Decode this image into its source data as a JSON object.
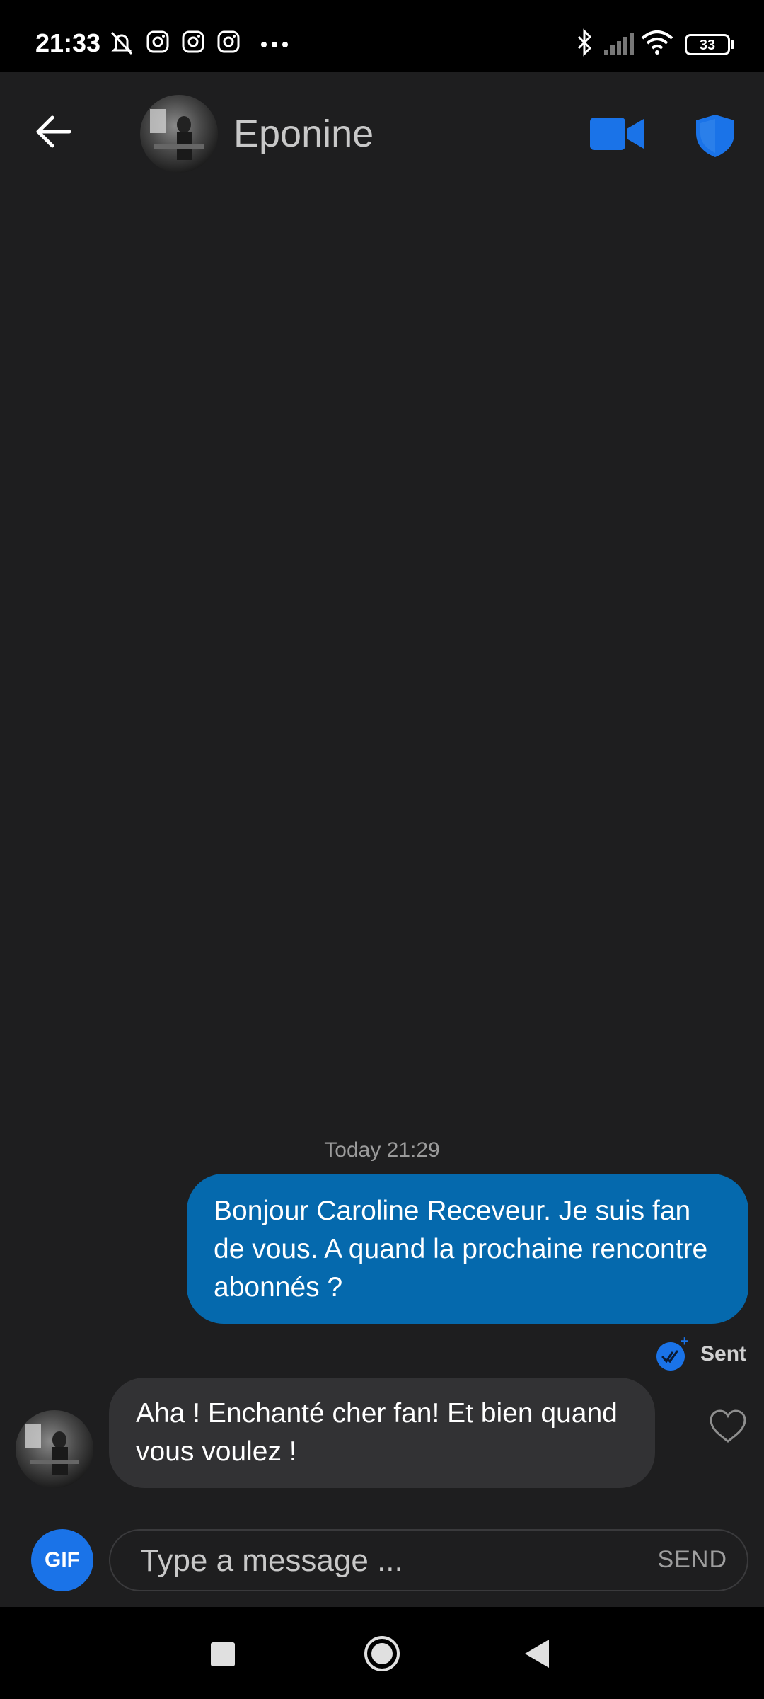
{
  "status_bar": {
    "time": "21:33",
    "battery": "33",
    "icons": [
      "muted-bell-icon",
      "instagram-icon",
      "instagram-icon",
      "instagram-icon",
      "more-dots-icon",
      "bluetooth-icon",
      "signal-icon",
      "wifi-icon",
      "battery-icon"
    ]
  },
  "header": {
    "contact_name": "Eponine",
    "icons": {
      "back": "arrow-left-icon",
      "video": "video-camera-icon",
      "safety": "shield-icon"
    }
  },
  "conversation": {
    "timestamp": "Today 21:29",
    "messages": [
      {
        "direction": "outgoing",
        "text": "Bonjour Caroline Receveur. Je suis fan de vous. A quand la prochaine rencontre abonnés ?"
      },
      {
        "direction": "incoming",
        "text": "Aha ! Enchanté cher fan! Et bien quand vous voulez !"
      }
    ],
    "status": "Sent"
  },
  "composer": {
    "gif_label": "GIF",
    "placeholder": "Type a message ...",
    "send_label": "SEND"
  },
  "colors": {
    "accent": "#1a73e8",
    "outgoing_bubble": "#0569ad",
    "incoming_bubble": "#323234",
    "background": "#1e1e1f"
  }
}
